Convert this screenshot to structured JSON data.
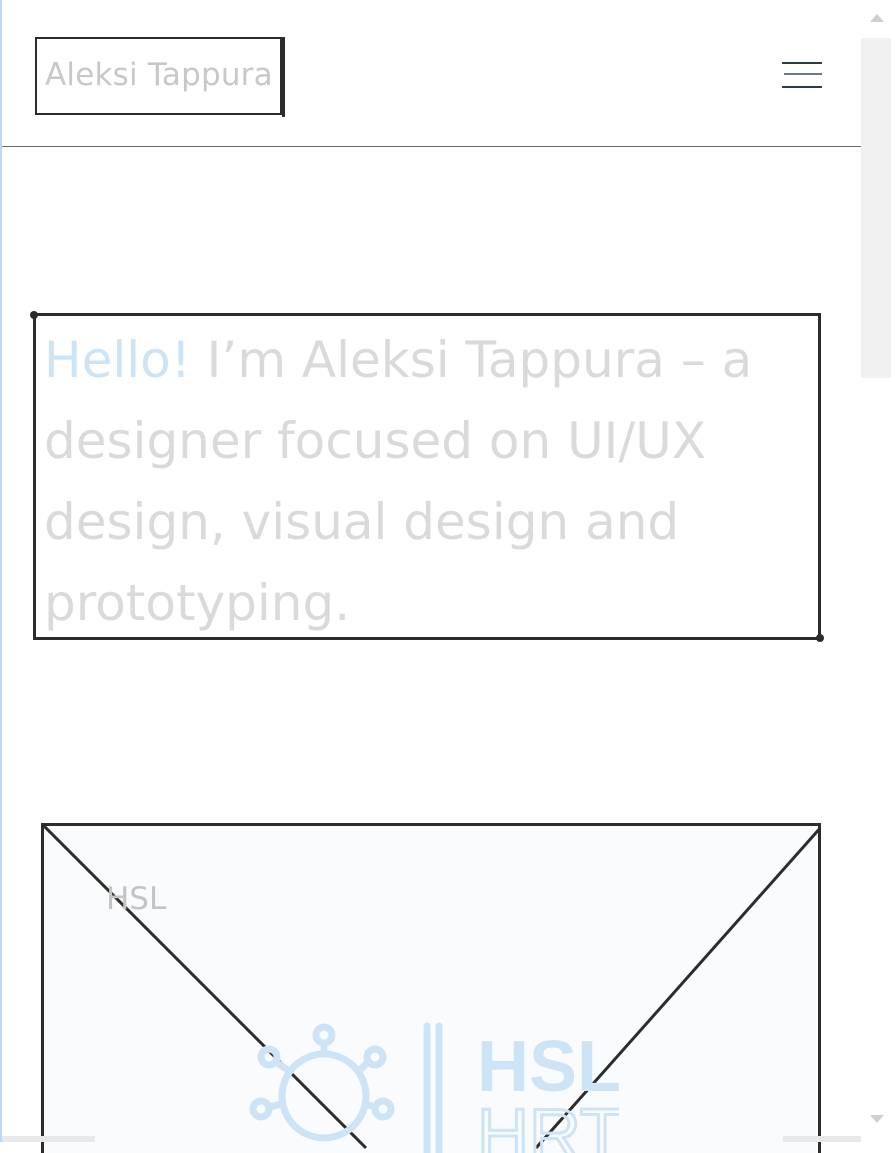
{
  "header": {
    "logo_text": "Aleksi Tappura",
    "menu_icon": "hamburger-menu-icon"
  },
  "intro": {
    "greeting": "Hello!",
    "body": " I’m Aleksi Tappura – a designer focused on UI/UX design, visual design and prototyping.",
    "greeting_color": "#cde4f7",
    "text_color": "#dadada"
  },
  "project": {
    "label": "HSL",
    "image_placeholder_icon": "image-placeholder-icon",
    "logo": {
      "icon": "hsl-hrt-logo-icon",
      "color": "#cde4f7"
    }
  },
  "scrollbar": {
    "up_icon": "scroll-up-arrow-icon",
    "down_icon": "scroll-down-arrow-icon"
  }
}
